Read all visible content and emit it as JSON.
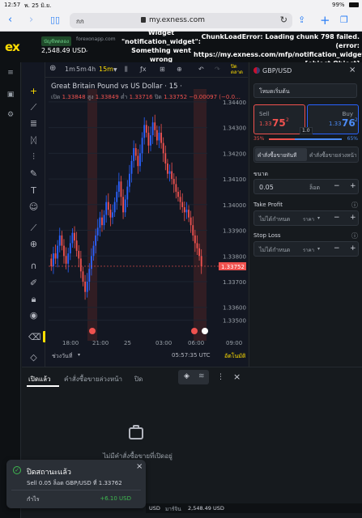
{
  "ios": {
    "time": "12:57",
    "date": "พ. 25 มิ.ย.",
    "battery": "99%"
  },
  "safari": {
    "aa_label": "กก",
    "url": "my.exness.com"
  },
  "header": {
    "logo": "ex",
    "account_type": "บัญชีทดลอง",
    "server": "forexonapp.com",
    "balance": "2,548.49 USD",
    "error_widget": "Widget \"notification_widget\": Something went wrong",
    "error_chunk": "ChunkLoadError: Loading chunk 798 failed. (error: https://my.exness.com/mfp/notification_widget/...) [object Object]"
  },
  "chart_toolbar": {
    "timeframes": [
      "1m",
      "5m",
      "4h",
      "15m"
    ],
    "active": "15m",
    "status": "ปิดตลาด"
  },
  "chart": {
    "title": "Great Britain Pound vs US Dollar · 15 ·",
    "ohlc": {
      "open_label": "เปิด",
      "open": "1.33848",
      "high_label": "สูง",
      "high": "1.33849",
      "low_label": "ต่ำ",
      "low": "1.33716",
      "close_label": "ปิด",
      "close": "1.33752",
      "change": "−0.00097 (−0.0…"
    },
    "price_tag": "1.33752",
    "x_ticks": [
      "18:00",
      "21:00",
      "25",
      "03:00",
      "06:00",
      "09:00"
    ],
    "range_label": "ช่วงวันที่",
    "clock": "05:57:35 UTC",
    "auto_label": "อัตโนมัติ"
  },
  "chart_data": {
    "type": "candlestick",
    "title": "Great Britain Pound vs US Dollar · 15",
    "ylim": [
      1.3347,
      1.3445
    ],
    "y_ticks": [
      1.344,
      1.343,
      1.342,
      1.341,
      1.34,
      1.339,
      1.338,
      1.337,
      1.336,
      1.3355
    ],
    "y_tick_labels": [
      "1.34400",
      "1.34300",
      "1.34200",
      "1.34100",
      "1.34000",
      "1.33900",
      "1.33800",
      "1.33700",
      "1.33600",
      "1.33500"
    ],
    "close_series": [
      1.3376,
      1.3381,
      1.3379,
      1.3384,
      1.3388,
      1.3384,
      1.338,
      1.3377,
      1.3381,
      1.3385,
      1.3389,
      1.3386,
      1.3382,
      1.3379,
      1.3374,
      1.337,
      1.3366,
      1.337,
      1.3375,
      1.338,
      1.3384,
      1.3388,
      1.3391,
      1.3395,
      1.3392,
      1.3396,
      1.3401,
      1.3398,
      1.3395,
      1.3397,
      1.3401,
      1.3405,
      1.3409,
      1.3403,
      1.3397,
      1.3402,
      1.3407,
      1.3412,
      1.3417,
      1.3422,
      1.3419,
      1.3415,
      1.342,
      1.3426,
      1.3431,
      1.3428,
      1.3423,
      1.3427,
      1.3432,
      1.3429,
      1.3425,
      1.3428,
      1.3424,
      1.342,
      1.3416,
      1.3412,
      1.3413,
      1.341,
      1.3408,
      1.3405,
      1.3403,
      1.3401,
      1.3399,
      1.3397,
      1.3398,
      1.3395,
      1.3392,
      1.3388,
      1.3385,
      1.3383,
      1.338,
      1.3376
    ],
    "highlight_sessions": [
      "21:00",
      "06:00"
    ]
  },
  "trade_panel": {
    "symbol": "GBP/USD",
    "mode": "โหมดเริ่มต้น",
    "sell_label": "Sell",
    "sell_price_main": "1.33",
    "sell_price_big": "75",
    "sell_price_sup": "2",
    "buy_label": "Buy",
    "buy_price_main": "1.33",
    "buy_price_big": "76",
    "buy_price_sup": "2",
    "spread": "1.0",
    "sell_pct": "35%",
    "buy_pct": "65%",
    "sell_ratio": 0.35,
    "order_type_market": "คำสั่งซื้อขายทันที",
    "order_type_pending": "คำสั่งซื้อขายล่วงหน้า",
    "volume_label": "ขนาด",
    "volume_value": "0.05",
    "volume_unit": "ล็อต",
    "take_profit_label": "Take Profit",
    "take_profit_value": "ไม่ได้กำหนด",
    "take_profit_unit": "ราคา",
    "stop_loss_label": "Stop Loss",
    "stop_loss_value": "ไม่ได้กำหนด",
    "stop_loss_unit": "ราคา"
  },
  "bottom": {
    "tabs": [
      "เปิดแล้ว",
      "คำสั่งซื้อขายล่วงหน้า",
      "ปิด"
    ],
    "empty_text": "ไม่มีคำสั่งซื้อขายที่เปิดอยู่"
  },
  "toast": {
    "title": "ปิดสถานะแล้ว",
    "body": "Sell 0.05 ล็อต GBP/USD ที่ 1.33762",
    "profit_label": "กำไร",
    "profit_value": "+6.10 USD"
  },
  "footer": {
    "left": "USD",
    "balance_label": "มาร์จิน",
    "balance": "2,548.49 USD"
  },
  "colors": {
    "up": "#2962ff",
    "down": "#f0524f",
    "brand": "#ffde02"
  }
}
